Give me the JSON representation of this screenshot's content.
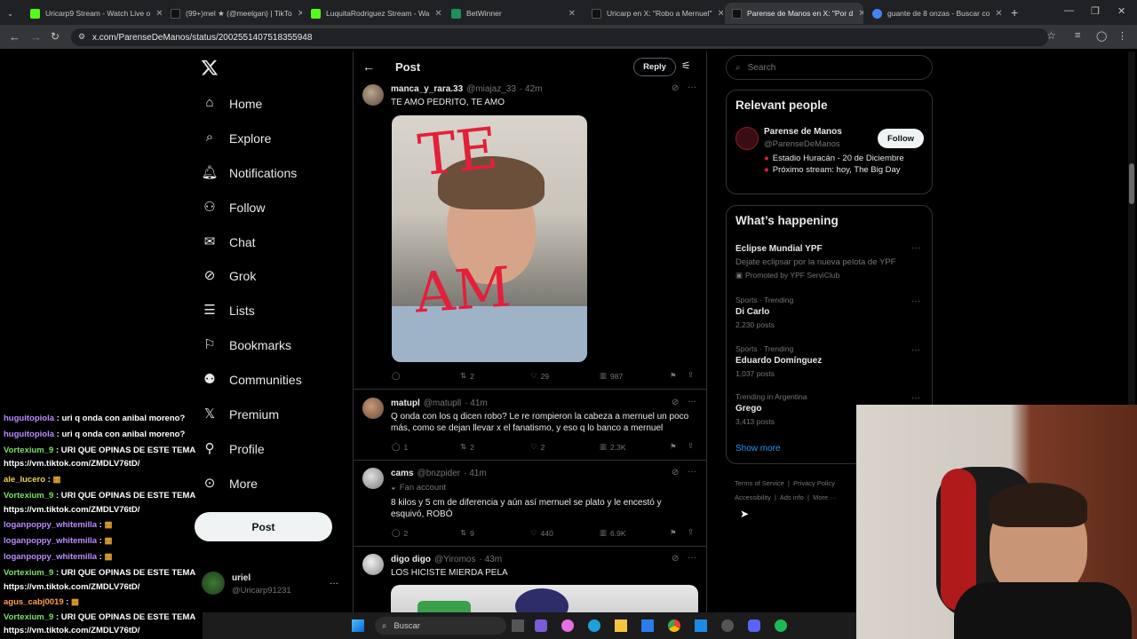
{
  "browser": {
    "tabs": [
      {
        "label": "Uricarp9 Stream - Watch Live o",
        "fav": "#53fc18"
      },
      {
        "label": "(99+)mel ★ (@meelgan) | TikTo",
        "fav": "#111"
      },
      {
        "label": "LuquitaRodriguez Stream - Wa",
        "fav": "#53fc18"
      },
      {
        "label": "BetWinner",
        "fav": "#1e8e5a"
      },
      {
        "label": "Uricarp en X: \"Robo a Mernuel\"",
        "fav": "#111"
      },
      {
        "label": "Parense de Manos en X: \"Por d",
        "fav": "#111"
      },
      {
        "label": "guante de 8 onzas - Buscar co",
        "fav": "#4285f4"
      }
    ],
    "url": "x.com/ParenseDeManos/status/2002551407518355948"
  },
  "nav": {
    "items": [
      {
        "label": "Home",
        "icon": "home-icon"
      },
      {
        "label": "Explore",
        "icon": "search-icon"
      },
      {
        "label": "Notifications",
        "icon": "bell-icon"
      },
      {
        "label": "Follow",
        "icon": "add-person-icon"
      },
      {
        "label": "Chat",
        "icon": "mail-icon"
      },
      {
        "label": "Grok",
        "icon": "grok-icon"
      },
      {
        "label": "Lists",
        "icon": "list-icon"
      },
      {
        "label": "Bookmarks",
        "icon": "bookmark-icon"
      },
      {
        "label": "Communities",
        "icon": "people-icon"
      },
      {
        "label": "Premium",
        "icon": "x-logo-icon"
      },
      {
        "label": "Profile",
        "icon": "person-icon"
      },
      {
        "label": "More",
        "icon": "more-circle-icon"
      }
    ],
    "post_button": "Post",
    "account": {
      "name": "uriel",
      "handle": "@Uricarp91231"
    }
  },
  "header": {
    "title": "Post",
    "reply": "Reply"
  },
  "replies": [
    {
      "name": "manca_y_rara.33",
      "handle": "@miajaz_33",
      "time": "· 42m",
      "text": "TE AMO PEDRITO, TE AMO",
      "replies": "",
      "reposts": "2",
      "likes": "29",
      "views": "987"
    },
    {
      "name": "matupl",
      "handle": "@matupll",
      "time": "· 41m",
      "text": "Q onda con los q dicen robo? Le re rompieron la cabeza a mernuel un poco más,  como se dejan llevar x el fanatismo, y eso q lo banco a mernuel",
      "replies": "1",
      "reposts": "2",
      "likes": "2",
      "views": "2.3K"
    },
    {
      "name": "cams",
      "handle": "@bnzpider",
      "time": "· 41m",
      "badge": "Fan account",
      "text": "8 kilos y 5 cm de diferencia y aún así mernuel se plato y le encestó y esquivó, ROBÓ",
      "replies": "2",
      "reposts": "9",
      "likes": "440",
      "views": "6.9K"
    },
    {
      "name": "digo digo",
      "handle": "@Yiromos",
      "time": "· 43m",
      "text": "LOS HICISTE MIERDA PELA"
    }
  ],
  "image_text": {
    "top": "TE",
    "bottom": "AM"
  },
  "search": {
    "placeholder": "Search"
  },
  "relevant": {
    "title": "Relevant people",
    "name": "Parense de Manos",
    "handle": "@ParenseDeManos",
    "follow": "Follow",
    "bio1": "Estadio Huracán - 20 de Diciembre",
    "bio2": "Próximo stream: hoy, The Big Day"
  },
  "happening": {
    "title": "What’s happening",
    "items": [
      {
        "meta": "",
        "title": "Eclipse Mundial YPF",
        "sub": "Dejate eclipsar por la nueva pelota de YPF",
        "promo": "Promoted by YPF ServiClub"
      },
      {
        "meta": "Sports · Trending",
        "title": "Di Carlo",
        "sub": "2,230 posts"
      },
      {
        "meta": "Sports · Trending",
        "title": "Eduardo Domínguez",
        "sub": "1,037 posts"
      },
      {
        "meta": "Trending in Argentina",
        "title": "Grego",
        "sub": "3,413 posts"
      }
    ],
    "show_more": "Show more"
  },
  "footer": [
    "Terms of Service",
    "Privacy Policy",
    "Accessibility",
    "Ads info",
    "More ···"
  ],
  "chat": [
    {
      "user": "huguitopiola",
      "msg": " : uri q onda con anibal moreno?",
      "c": "purple"
    },
    {
      "user": "huguitopiola",
      "msg": " : uri q onda con anibal moreno?",
      "c": "purple"
    },
    {
      "user": "Vortexium_9",
      "msg": " : URI QUE OPINAS DE ESTE TEMA",
      "c": "green"
    },
    {
      "user": "",
      "msg": "https://vm.tiktok.com/ZMDLV76tD/",
      "c": ""
    },
    {
      "user": "ale_lucero",
      "msg": " :",
      "c": "yellow"
    },
    {
      "user": "Vortexium_9",
      "msg": " : URI QUE OPINAS DE ESTE TEMA",
      "c": "green"
    },
    {
      "user": "",
      "msg": "https://vm.tiktok.com/ZMDLV76tD/",
      "c": ""
    },
    {
      "user": "loganpoppy_whitemilla",
      "msg": " :",
      "c": "purple"
    },
    {
      "user": "loganpoppy_whitemilla",
      "msg": " :",
      "c": "purple"
    },
    {
      "user": "loganpoppy_whitemilla",
      "msg": " :",
      "c": "purple"
    },
    {
      "user": "Vortexium_9",
      "msg": " : URI QUE OPINAS DE ESTE TEMA",
      "c": "green"
    },
    {
      "user": "",
      "msg": "https://vm.tiktok.com/ZMDLV76tD/",
      "c": ""
    },
    {
      "user": "agus_cabj0019",
      "msg": " :",
      "c": "orange"
    },
    {
      "user": "Vortexium_9",
      "msg": " : URI QUE OPINAS DE ESTE TEMA",
      "c": "green"
    },
    {
      "user": "",
      "msg": "https://vm.tiktok.com/ZMDLV76tD/",
      "c": ""
    }
  ],
  "taskbar": {
    "search": "Buscar"
  }
}
